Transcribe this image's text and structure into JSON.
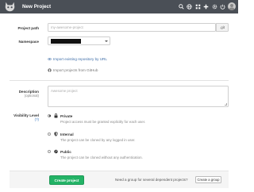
{
  "header": {
    "title": "New Project",
    "icons": [
      "search-icon",
      "globe-icon",
      "grid-icon",
      "plus-icon",
      "gear-icon",
      "power-icon",
      "avatar"
    ],
    "bg_color": "#4a4f56"
  },
  "form": {
    "project_path": {
      "label": "Project path",
      "placeholder": "my-awesome-project",
      "suffix": ".git"
    },
    "namespace": {
      "label": "Namespace",
      "value_redacted": true
    },
    "import_links": [
      {
        "label": "Import existing repository by URL",
        "icon": "link-icon"
      },
      {
        "label": "Import projects from GitHub",
        "icon": "github-icon"
      }
    ],
    "description": {
      "label": "Description",
      "sublabel": "(optional)",
      "placeholder": "Awesome project"
    },
    "visibility": {
      "label": "Visibility Level",
      "help": "(?)",
      "selected": "Private",
      "options": [
        {
          "title": "Private",
          "icon": "lock-icon",
          "description": "Project access must be granted explicitly for each user."
        },
        {
          "title": "Internal",
          "icon": "shield-icon",
          "description": "The project can be cloned by any logged in user."
        },
        {
          "title": "Public",
          "icon": "globe-icon",
          "description": "The project can be cloned without any authentication."
        }
      ]
    }
  },
  "footer": {
    "create_label": "Create project",
    "group_hint": "Need a group for several dependent projects?",
    "create_group_label": "Create a group"
  },
  "colors": {
    "accent_green": "#23b366",
    "link_blue": "#3f6ea8"
  }
}
